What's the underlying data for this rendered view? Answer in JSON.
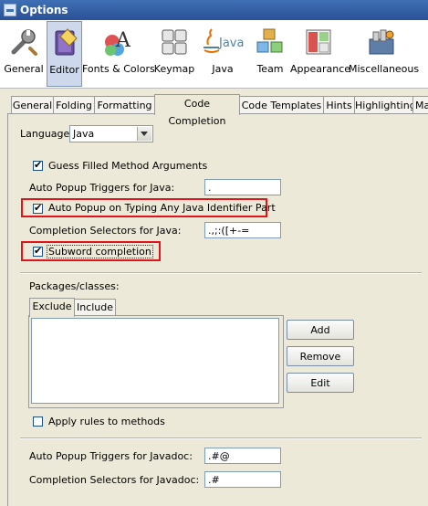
{
  "window": {
    "title": "Options"
  },
  "toolbar": {
    "items": [
      {
        "label": "General",
        "icon": "wrench-icon"
      },
      {
        "label": "Editor",
        "icon": "book-icon",
        "selected": true
      },
      {
        "label": "Fonts & Colors",
        "icon": "font-icon"
      },
      {
        "label": "Keymap",
        "icon": "keyboard-icon"
      },
      {
        "label": "Java",
        "icon": "java-icon"
      },
      {
        "label": "Team",
        "icon": "cubes-icon"
      },
      {
        "label": "Appearance",
        "icon": "window-icon"
      },
      {
        "label": "Miscellaneous",
        "icon": "toolbox-icon"
      }
    ]
  },
  "tabs": [
    "General",
    "Folding",
    "Formatting",
    "Code Completion",
    "Code Templates",
    "Hints",
    "Highlighting",
    "Ma"
  ],
  "selected_tab": "Code Completion",
  "form": {
    "language_label": "Language:",
    "language_value": "Java",
    "guess_filled_label": "Guess Filled Method Arguments",
    "auto_popup_triggers_java_label": "Auto Popup Triggers for Java:",
    "auto_popup_triggers_java_value": ".",
    "auto_popup_typing_label": "Auto Popup on Typing Any Java Identifier Part",
    "completion_selectors_java_label": "Completion Selectors for Java:",
    "completion_selectors_java_value": ".,;:([+-=",
    "subword_label": "Subword completion",
    "packages_label": "Packages/classes:",
    "exclude_tab": "Exclude",
    "include_tab": "Include",
    "add_button": "Add",
    "remove_button": "Remove",
    "edit_button": "Edit",
    "apply_rules_label": "Apply rules to methods",
    "auto_popup_triggers_javadoc_label": "Auto Popup Triggers for Javadoc:",
    "auto_popup_triggers_javadoc_value": ".#@",
    "completion_selectors_javadoc_label": "Completion Selectors for Javadoc:",
    "completion_selectors_javadoc_value": ".#"
  },
  "checkbox_states": {
    "guess_filled": true,
    "auto_popup_typing": true,
    "subword": true,
    "apply_rules": false
  },
  "colors": {
    "highlight_box": "#e0141b",
    "title_bar": "#2a5198"
  }
}
